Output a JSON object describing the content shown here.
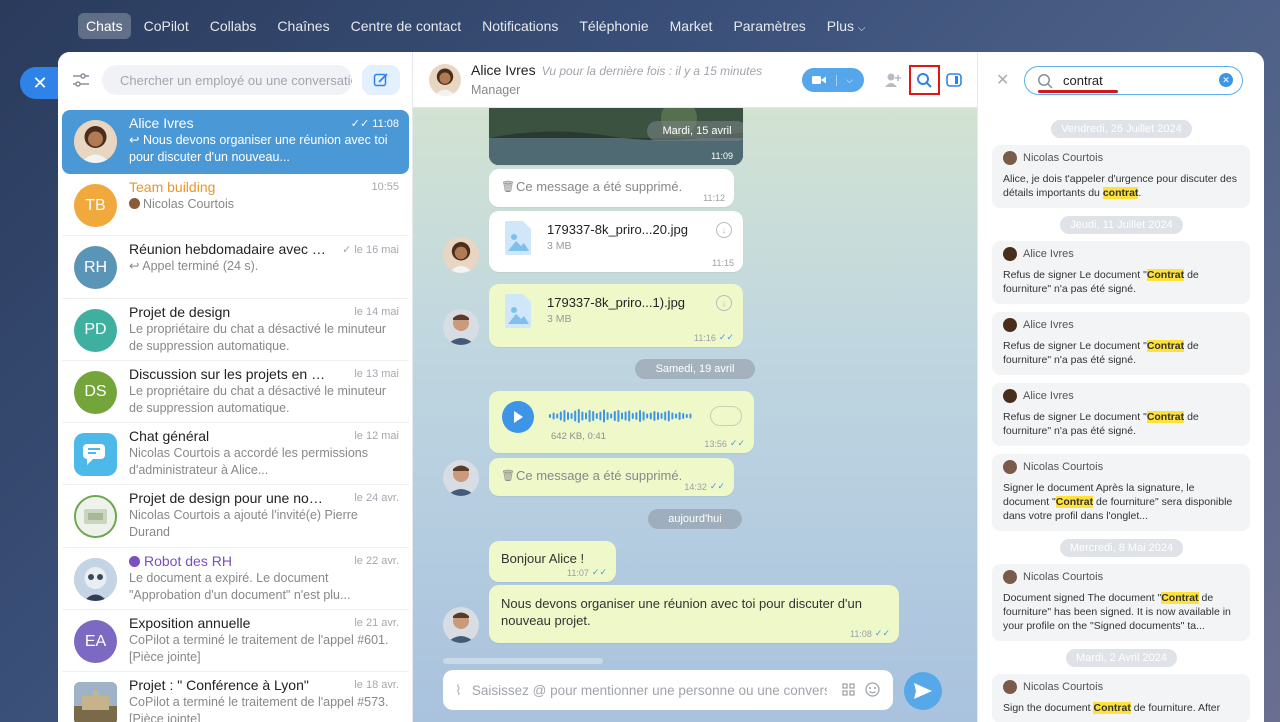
{
  "nav": {
    "items": [
      "Chats",
      "CoPilot",
      "Collabs",
      "Chaînes",
      "Centre de contact",
      "Notifications",
      "Téléphonie",
      "Market",
      "Paramètres",
      "Plus"
    ]
  },
  "sidebar": {
    "search_placeholder": "Chercher un employé ou une conversation",
    "chats": [
      {
        "title": "Alice Ivres",
        "preview": "↩ Nous devons organiser une réunion avec toi pour discuter d'un nouveau...",
        "time": "11:08",
        "initials": "",
        "color": "#c98d64"
      },
      {
        "title": "Team building",
        "preview": "Nicolas Courtois",
        "time": "10:55",
        "initials": "TB",
        "color": "#f0a93a"
      },
      {
        "title": "Réunion hebdomadaire avec le...",
        "preview": "↩ Appel terminé (24 s).",
        "time": "le 16 mai",
        "initials": "RH",
        "color": "#5a95b8"
      },
      {
        "title": "Projet de design",
        "preview": "Le propriétaire du chat a désactivé le minuteur de suppression automatique.",
        "time": "le 14 mai",
        "initials": "PD",
        "color": "#3fb0a0"
      },
      {
        "title": "Discussion sur les projets en cours",
        "preview": "Le propriétaire du chat a désactivé le minuteur de suppression automatique.",
        "time": "le 13 mai",
        "initials": "DS",
        "color": "#74a53a"
      },
      {
        "title": "Chat général",
        "preview": "Nicolas Courtois a accordé les permissions d'administrateur à Alice...",
        "time": "le 12 mai",
        "initials": "",
        "color": "#4cb9e8"
      },
      {
        "title": "Projet de design pour une nouvel...",
        "preview": "Nicolas Courtois a ajouté l'invité(e) Pierre Durand",
        "time": "le 24 avr.",
        "initials": "",
        "color": "#e8efe2"
      },
      {
        "title": "Robot des RH",
        "preview": "Le document a expiré. Le document \"Approbation d'un document\" n'est plu...",
        "time": "le 22 avr.",
        "initials": "",
        "color": "#b7c6d6"
      },
      {
        "title": "Exposition annuelle",
        "preview": "CoPilot a terminé le traitement de l'appel #601. [Pièce jointe]",
        "time": "le 21 avr.",
        "initials": "EA",
        "color": "#7c6ac2"
      },
      {
        "title": "Projet : \" Conférence à Lyon\"",
        "preview": "CoPilot a terminé le traitement de l'appel #573. [Pièce jointe]",
        "time": "le 18 avr.",
        "initials": "",
        "color": "#8a9a6a"
      }
    ]
  },
  "header": {
    "name": "Alice Ivres",
    "status": "Vu pour la dernière fois : il y a 15 minutes",
    "role": "Manager"
  },
  "messages": {
    "photo_date": "Mardi, 15 avril",
    "photo_time": "11:09",
    "deleted_1": "Ce message a été supprimé.",
    "deleted_1_time": "11:12",
    "file_1_name": "179337-8k_priro...20.jpg",
    "file_1_size": "3 MB",
    "file_1_time": "11:15",
    "file_2_name": "179337-8k_priro...1).jpg",
    "file_2_size": "3 MB",
    "file_2_time": "11:16",
    "date_2": "Samedi, 19 avril",
    "voice_info": "642 KB, 0:41",
    "voice_time": "13:56",
    "deleted_2": "Ce message a été supprimé.",
    "deleted_2_time": "14:32",
    "date_3": "aujourd'hui",
    "msg_1": "Bonjour Alice !",
    "msg_1_time": "11:07",
    "msg_2": "Nous devons organiser une réunion avec toi pour discuter d'un nouveau projet.",
    "msg_2_time": "11:08"
  },
  "composer": {
    "placeholder": "Saisissez @ pour mentionner une personne ou une conversation"
  },
  "search_panel": {
    "query": "contrat",
    "results": [
      {
        "date": "Vendredi, 26 Juillet 2024",
        "author": "Nicolas Courtois",
        "before": "Alice, je dois t'appeler d'urgence pour discuter des détails importants du ",
        "match": "contrat",
        "after": "."
      },
      {
        "date": "Jeudi, 11 Juillet 2024",
        "author": "Alice Ivres",
        "before": "Refus de signer Le document \"",
        "match": "Contrat",
        "after": " de fourniture\" n'a pas été signé."
      },
      {
        "date": "",
        "author": "Alice Ivres",
        "before": "Refus de signer Le document \"",
        "match": "Contrat",
        "after": " de fourniture\" n'a pas été signé."
      },
      {
        "date": "",
        "author": "Alice Ivres",
        "before": "Refus de signer Le document \"",
        "match": "Contrat",
        "after": " de fourniture\" n'a pas été signé."
      },
      {
        "date": "",
        "author": "Nicolas Courtois",
        "before": "Signer le document Après la signature, le document \"",
        "match": "Contrat",
        "after": " de fourniture\" sera disponible dans votre profil dans l'onglet..."
      },
      {
        "date": "Mercredi, 8 Mai 2024",
        "author": "Nicolas Courtois",
        "before": "Document signed The document \"",
        "match": "Contrat",
        "after": " de fourniture\" has been signed. It is now available in your profile on the \"Signed documents\" ta..."
      },
      {
        "date": "Mardi, 2 Avril 2024",
        "author": "Nicolas Courtois",
        "before": "Sign the document ",
        "match": "Contrat",
        "after": " de fourniture. After"
      }
    ]
  },
  "colors": {
    "accent": "#2f83e8",
    "highlight": "#ffe13b",
    "annotation": "#e01616"
  }
}
